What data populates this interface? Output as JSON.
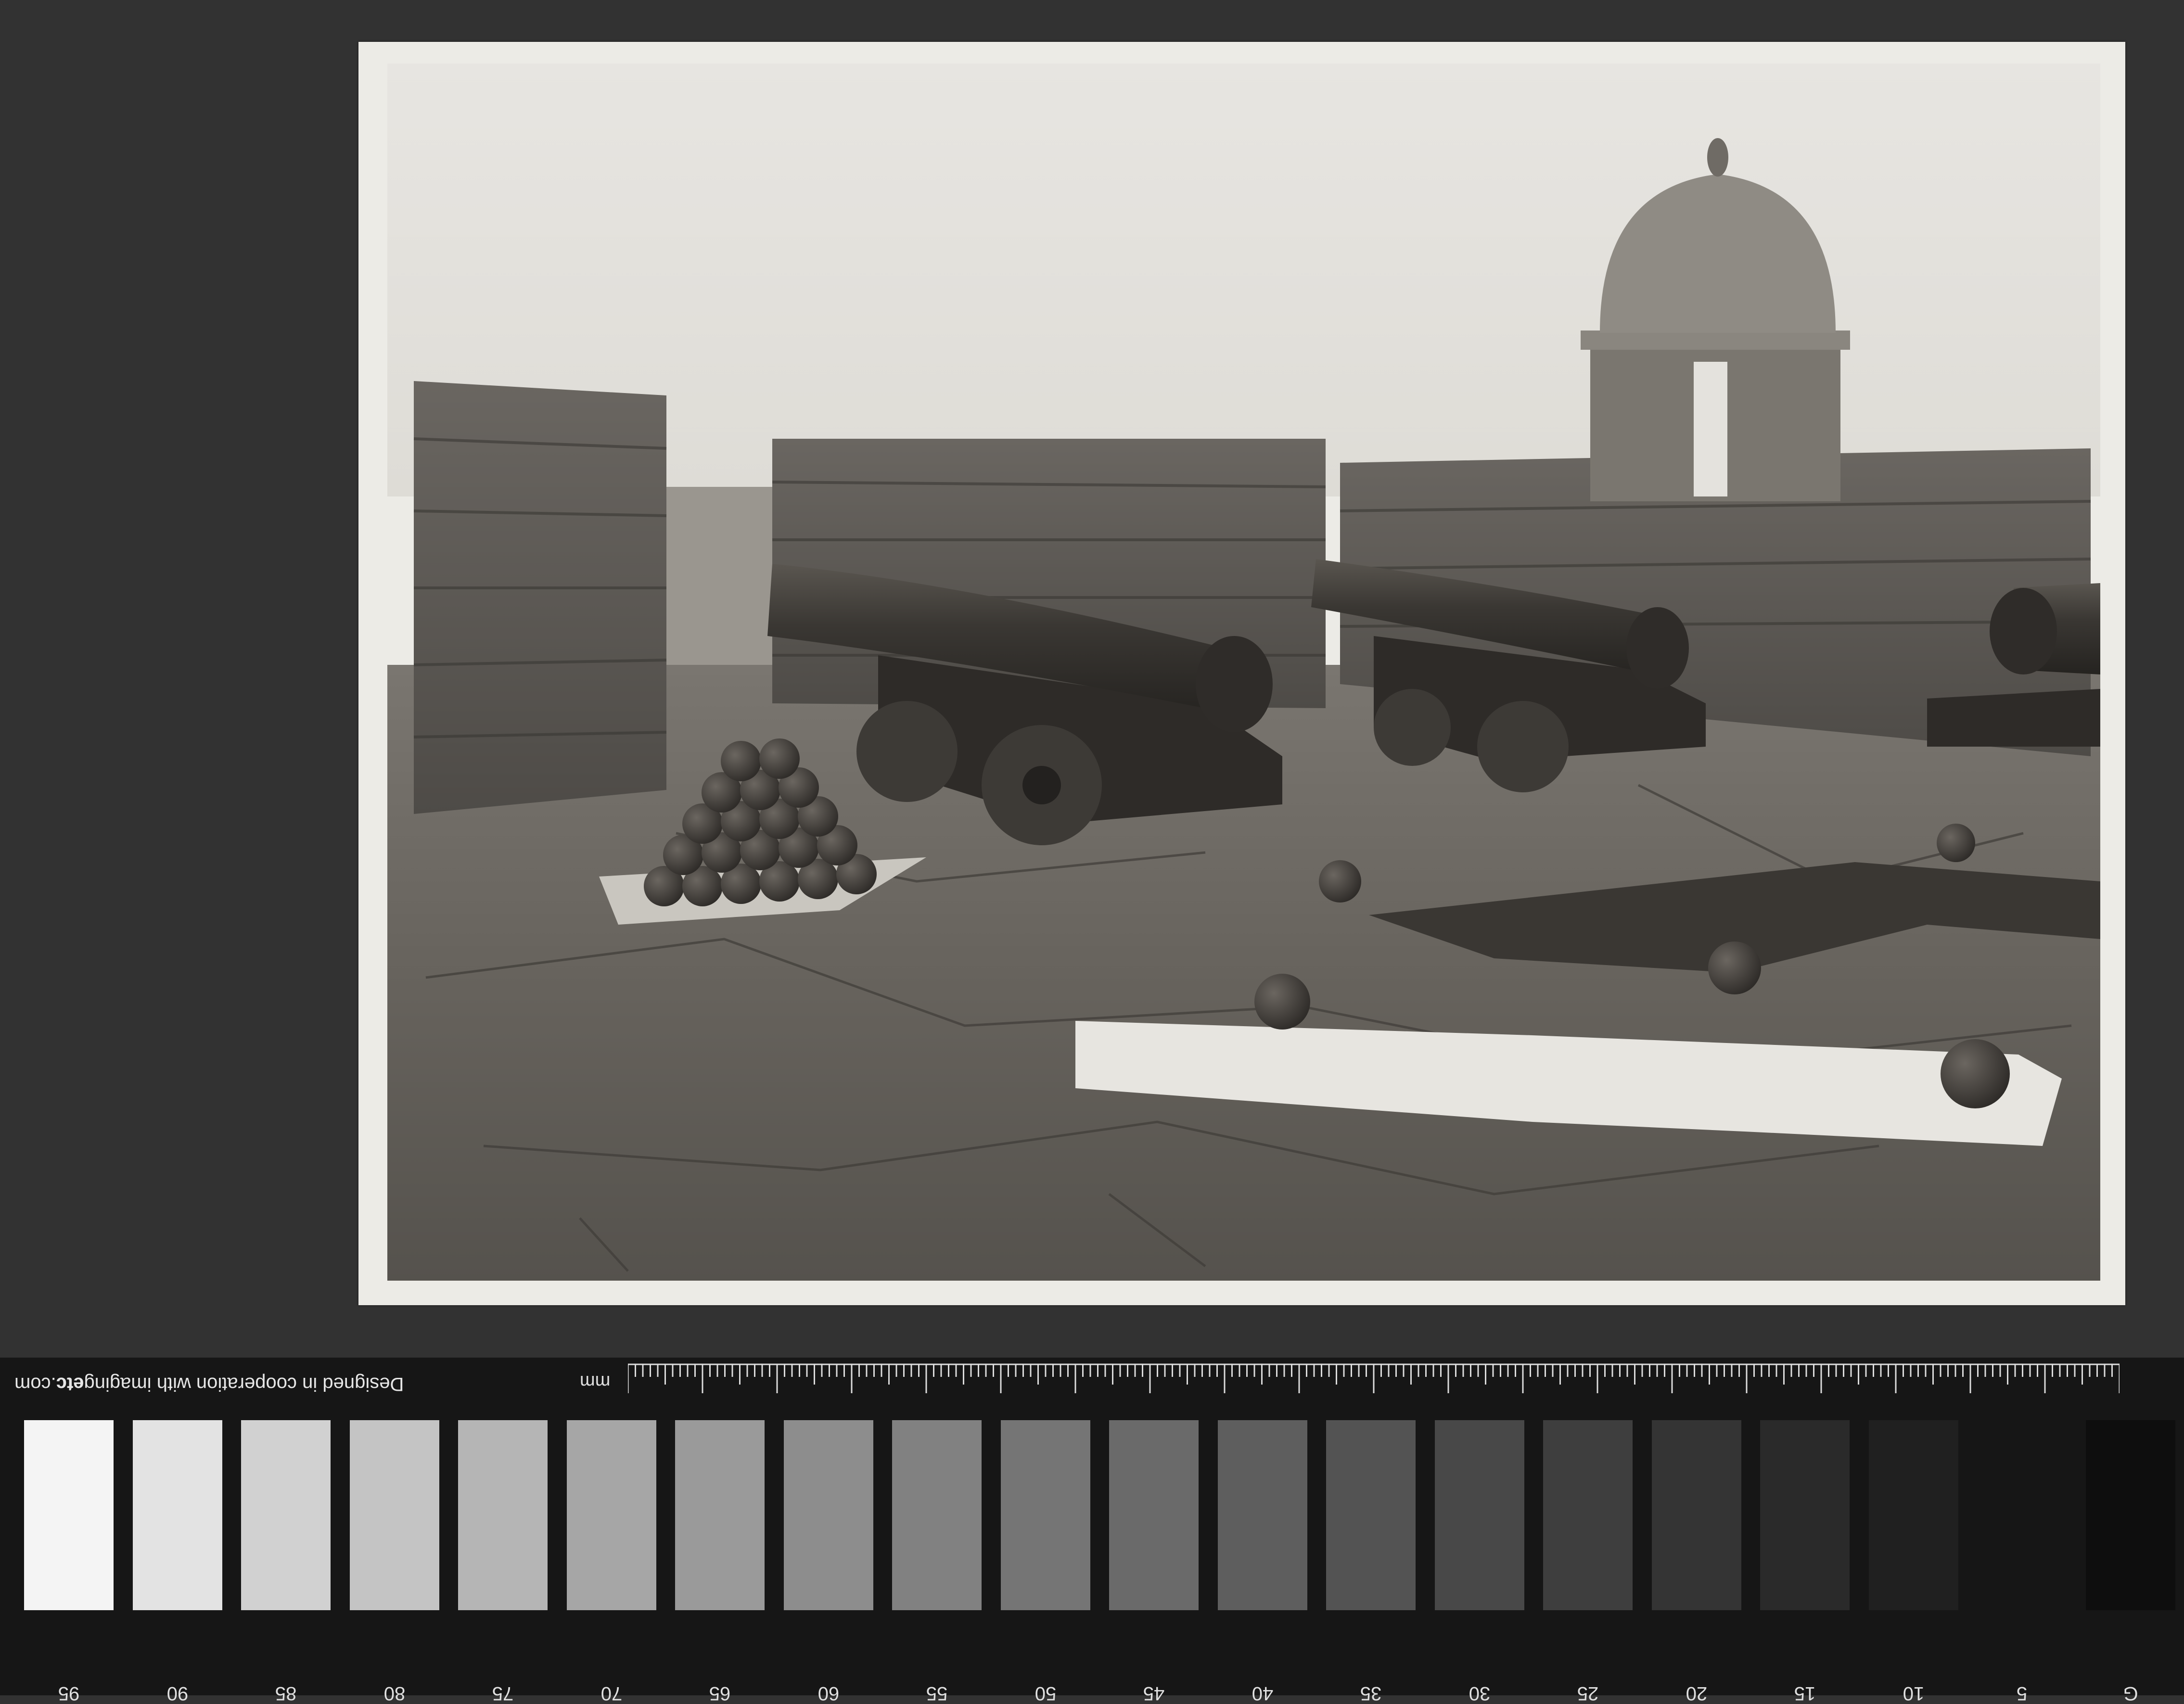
{
  "target": {
    "credit_prefix": "Designed in cooperation with imaging",
    "credit_bold": "etc",
    "credit_suffix": ".com",
    "ruler_unit": "mm",
    "patch_labels": [
      "95",
      "90",
      "85",
      "80",
      "75",
      "70",
      "65",
      "60",
      "55",
      "50",
      "45",
      "40",
      "35",
      "30",
      "25",
      "20",
      "15",
      "10",
      "5",
      "G"
    ],
    "patch_colors": [
      "#f4f4f4",
      "#e3e3e3",
      "#d1d1d1",
      "#c4c4c4",
      "#b5b5b5",
      "#a6a6a6",
      "#9a9a9a",
      "#8d8d8d",
      "#818181",
      "#757575",
      "#6a6a6a",
      "#5e5e5e",
      "#535353",
      "#484848",
      "#3e3e3e",
      "#343434",
      "#2a2a2a",
      "#202020",
      "#161616",
      "#0e0e0e"
    ]
  }
}
